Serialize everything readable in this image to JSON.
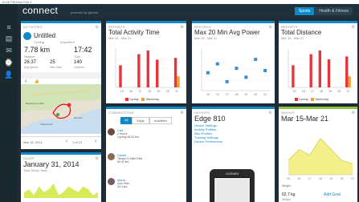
{
  "status_line": "12:06 PM Mon Feb 2",
  "app": {
    "logo_main": "connect",
    "logo_sub": "GARMIN",
    "topbar_text": "powered by garmin"
  },
  "tabs": [
    {
      "label": "Sports"
    },
    {
      "label": "Health & Fitness"
    }
  ],
  "activities": {
    "header": "ACTIVITIES",
    "name": "Untitled",
    "meta1": "Cycling",
    "meta2": "Anywhere",
    "distance": "7.78 km",
    "distance_label": "Distance",
    "time": "17:42",
    "time_label": "Time",
    "speed": "26.37",
    "speed_label": "Avg Speed",
    "elev": "25",
    "elev_label": "Elev Gain",
    "calories": "140",
    "calories_label": "Calories",
    "date": "Mar 15, 2014",
    "page": "1 of 12",
    "map_labels": [
      "Monaco",
      "Beaulieu-sur-Mer",
      "Villefranche"
    ]
  },
  "reports_time": {
    "header": "REPORTS",
    "title": "Total Activity Time",
    "sub": "Mar 15 - Mar 21",
    "legend": [
      "Cycling",
      "Swimming"
    ]
  },
  "reports_power": {
    "header": "REPORTS",
    "title": "Max 20 Min Avg Power",
    "sub": "Mar 15 - Mar 21"
  },
  "reports_distance": {
    "header": "REPORTS",
    "title": "Total Distance",
    "sub": "Mar 15 - Mar 21",
    "legend": [
      "Cycling",
      "Swimming"
    ]
  },
  "connections": {
    "header": "CONNECTIONS",
    "tabs": [
      "All",
      "Edge",
      "Activities"
    ],
    "rows": [
      {
        "name": "Carl",
        "text": "2 Hours",
        "stats": "Cycling 48.00 km"
      },
      {
        "name": "Daniel",
        "text": "Tampa FL Bike Ride",
        "stats": "60.42 km"
      },
      {
        "name": "Maria",
        "text": "Solo Ride",
        "stats": "34.4 km"
      }
    ]
  },
  "devices": {
    "header": "DEVICES",
    "title": "Edge 810",
    "links": [
      "Device Settings",
      "Activity Profiles",
      "Bike Profiles",
      "Training Settings",
      "Device Preferences"
    ],
    "device_brand": "GARMIN"
  },
  "weight": {
    "header": "WEIGHT",
    "title": "Mar 15-Mar 21",
    "weight_value": "62.7 kg",
    "weight_label": "Weight",
    "add_goal": "Add Goal",
    "unit_label": "Weight"
  },
  "sleep": {
    "header": "SLEEP",
    "title": "January 31, 2014",
    "sub": "Total Sleep Time"
  },
  "chart_data": [
    {
      "type": "bar",
      "title": "Total Activity Time",
      "categories": [
        "15",
        "16",
        "17",
        "18",
        "19",
        "20",
        "21"
      ],
      "series": [
        {
          "name": "Cycling",
          "values": [
            1.2,
            0,
            1.8,
            2.0,
            1.5,
            0,
            1.6
          ]
        },
        {
          "name": "Swimming",
          "values": [
            0,
            0,
            0,
            0,
            0,
            0,
            0.6
          ]
        }
      ],
      "colors": {
        "Cycling": "#e8343a",
        "Swimming": "#f39f32"
      }
    },
    {
      "type": "scatter",
      "title": "Max 20 Min Avg Power",
      "categories": [
        "15",
        "16",
        "17",
        "18",
        "19",
        "20",
        "21"
      ],
      "values": [
        280,
        300,
        260,
        290,
        270,
        310,
        285
      ],
      "colors": {
        "point": "#3a8dc5"
      }
    },
    {
      "type": "bar",
      "title": "Total Distance",
      "categories": [
        "15",
        "16",
        "17",
        "18",
        "19",
        "20",
        "21"
      ],
      "series": [
        {
          "name": "Cycling",
          "values": [
            30,
            0,
            45,
            50,
            38,
            0,
            42
          ]
        },
        {
          "name": "Swimming",
          "values": [
            0,
            0,
            0,
            0,
            0,
            0,
            15
          ]
        }
      ],
      "colors": {
        "Cycling": "#e8343a",
        "Swimming": "#f39f32"
      }
    },
    {
      "type": "area",
      "title": "Mar 15-Mar 21",
      "categories": [
        "15",
        "16",
        "17",
        "18",
        "19",
        "20",
        "21"
      ],
      "values": [
        63,
        64,
        63.5,
        65,
        64,
        63,
        62.7
      ],
      "colors": {
        "area": "#f4f08c",
        "line": "#c9c83c"
      }
    },
    {
      "type": "area",
      "title": "Total Sleep Time",
      "values": [
        3,
        4,
        2,
        5,
        3,
        4,
        6,
        2,
        3,
        5,
        4,
        3,
        5,
        4,
        2,
        3
      ],
      "colors": {
        "area": "#d7ea5a"
      }
    }
  ]
}
